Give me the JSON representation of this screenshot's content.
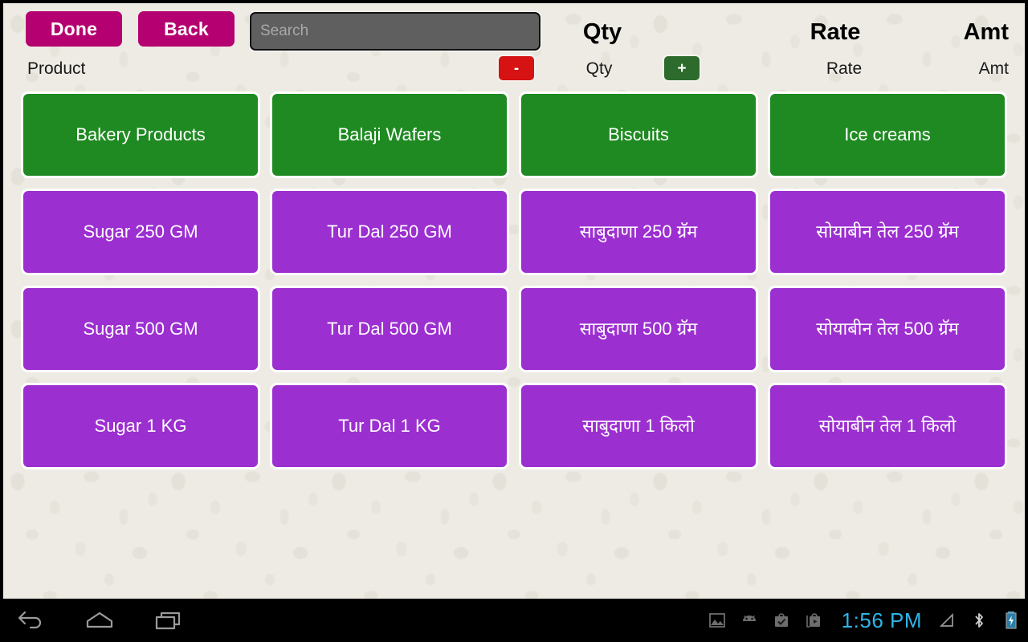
{
  "toolbar": {
    "done_label": "Done",
    "back_label": "Back",
    "search_value": "",
    "search_placeholder": "Search",
    "qty_header": "Qty",
    "rate_header": "Rate",
    "amt_header": "Amt"
  },
  "subheader": {
    "product_label": "Product",
    "minus_label": "-",
    "qty_label": "Qty",
    "plus_label": "+",
    "rate_label": "Rate",
    "amt_label": "Amt"
  },
  "grid": {
    "rows": [
      {
        "kind": "category",
        "tiles": [
          {
            "label": "Bakery Products"
          },
          {
            "label": "Balaji Wafers"
          },
          {
            "label": "Biscuits"
          },
          {
            "label": "Ice creams"
          }
        ]
      },
      {
        "kind": "product",
        "tiles": [
          {
            "label": "Sugar 250 GM"
          },
          {
            "label": "Tur Dal 250 GM"
          },
          {
            "label": "साबुदाणा 250 ग्रॅम"
          },
          {
            "label": "सोयाबीन तेल 250 ग्रॅम"
          }
        ]
      },
      {
        "kind": "product",
        "tiles": [
          {
            "label": "Sugar 500 GM"
          },
          {
            "label": "Tur Dal 500 GM"
          },
          {
            "label": "साबुदाणा 500 ग्रॅम"
          },
          {
            "label": "सोयाबीन तेल 500 ग्रॅम"
          }
        ]
      },
      {
        "kind": "product",
        "tiles": [
          {
            "label": "Sugar 1 KG"
          },
          {
            "label": "Tur Dal 1 KG"
          },
          {
            "label": "साबुदाणा 1 किलो"
          },
          {
            "label": "सोयाबीन तेल 1 किलो"
          }
        ]
      }
    ]
  },
  "navbar": {
    "back_icon": "back-arrow-icon",
    "home_icon": "home-icon",
    "recents_icon": "recent-apps-icon"
  },
  "statusbar": {
    "icons": [
      "screenshot-image-icon",
      "android-robot-icon",
      "checked-bag-icon",
      "play-store-bag-icon"
    ],
    "clock": "1:56 PM",
    "signal_icon": "signal-triangle-icon",
    "bluetooth_icon": "bluetooth-icon",
    "battery_icon": "battery-charging-icon"
  },
  "colors": {
    "accent_magenta": "#b40070",
    "category_green": "#1f8a22",
    "product_purple": "#9c2fd0",
    "minus_red": "#d61212",
    "plus_green": "#2c6b2c",
    "background": "#edebe4",
    "search_field": "#5f5f5f",
    "clock_blue": "#2fb4e8"
  }
}
